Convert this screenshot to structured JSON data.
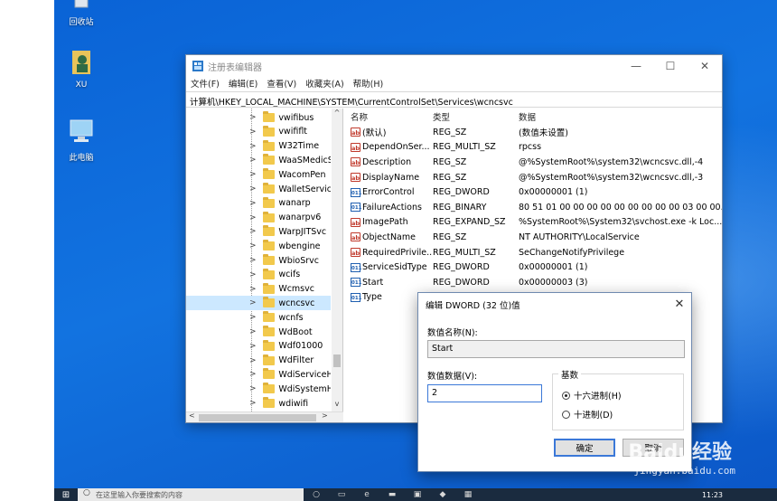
{
  "desktop": {
    "icons": [
      {
        "label": "回收站",
        "icon": "recycle-bin-icon"
      },
      {
        "label": "XU",
        "icon": "user-folder-icon"
      },
      {
        "label": "此电脑",
        "icon": "this-pc-icon"
      }
    ]
  },
  "regedit": {
    "title": "注册表编辑器",
    "menu": [
      "文件(F)",
      "编辑(E)",
      "查看(V)",
      "收藏夹(A)",
      "帮助(H)"
    ],
    "address": "计算机\\HKEY_LOCAL_MACHINE\\SYSTEM\\CurrentControlSet\\Services\\wcncsvc",
    "tree": [
      "vwifibus",
      "vwififlt",
      "W32Time",
      "WaaSMedicS",
      "WacomPen",
      "WalletService",
      "wanarp",
      "wanarpv6",
      "WarpJITSvc",
      "wbengine",
      "WbioSrvc",
      "wcifs",
      "Wcmsvc",
      "wcncsvc",
      "wcnfs",
      "WdBoot",
      "Wdf01000",
      "WdFilter",
      "WdiServiceH",
      "WdiSystemH",
      "wdiwifi"
    ],
    "tree_selected": "wcncsvc",
    "columns": {
      "name": "名称",
      "type": "类型",
      "data": "数据"
    },
    "values": [
      {
        "icon": "ab",
        "name": "(默认)",
        "type": "REG_SZ",
        "data": "(数值未设置)"
      },
      {
        "icon": "ab",
        "name": "DependOnSer...",
        "type": "REG_MULTI_SZ",
        "data": "rpcss"
      },
      {
        "icon": "ab",
        "name": "Description",
        "type": "REG_SZ",
        "data": "@%SystemRoot%\\system32\\wcncsvc.dll,-4"
      },
      {
        "icon": "ab",
        "name": "DisplayName",
        "type": "REG_SZ",
        "data": "@%SystemRoot%\\system32\\wcncsvc.dll,-3"
      },
      {
        "icon": "bin",
        "name": "ErrorControl",
        "type": "REG_DWORD",
        "data": "0x00000001 (1)"
      },
      {
        "icon": "bin",
        "name": "FailureActions",
        "type": "REG_BINARY",
        "data": "80 51 01 00 00 00 00 00 00 00 00 00 03 00 00..."
      },
      {
        "icon": "ab",
        "name": "ImagePath",
        "type": "REG_EXPAND_SZ",
        "data": "%SystemRoot%\\System32\\svchost.exe -k Loc..."
      },
      {
        "icon": "ab",
        "name": "ObjectName",
        "type": "REG_SZ",
        "data": "NT AUTHORITY\\LocalService"
      },
      {
        "icon": "ab",
        "name": "RequiredPrivile...",
        "type": "REG_MULTI_SZ",
        "data": "SeChangeNotifyPrivilege"
      },
      {
        "icon": "bin",
        "name": "ServiceSidType",
        "type": "REG_DWORD",
        "data": "0x00000001 (1)"
      },
      {
        "icon": "bin",
        "name": "Start",
        "type": "REG_DWORD",
        "data": "0x00000003 (3)"
      },
      {
        "icon": "bin",
        "name": "Type",
        "type": "",
        "data": ""
      }
    ]
  },
  "dialog": {
    "title": "编辑 DWORD (32 位)值",
    "name_label": "数值名称(N):",
    "name_value": "Start",
    "data_label": "数值数据(V):",
    "data_value": "2",
    "base_label": "基数",
    "radix_options": [
      "十六进制(H)",
      "十进制(D)"
    ],
    "radix_selected": "十六进制(H)",
    "ok_label": "确定",
    "cancel_label": "取消"
  },
  "taskbar": {
    "search_placeholder": "在这里输入你要搜索的内容",
    "time": "11:23"
  },
  "watermark": {
    "brand": "Baidu经验",
    "url": "jingyan.baidu.com"
  }
}
